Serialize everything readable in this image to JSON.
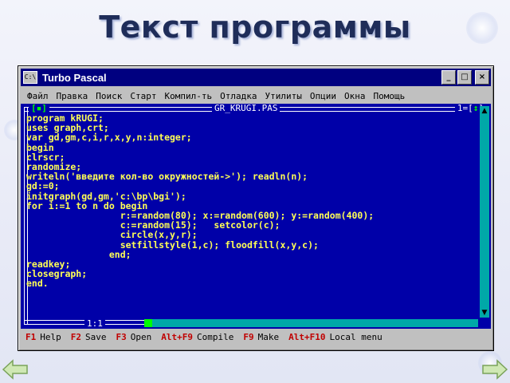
{
  "slide": {
    "title": "Текст программы"
  },
  "window": {
    "title": "Turbo Pascal",
    "icon_label": "C:\\",
    "buttons": {
      "minimize": "_",
      "maximize": "□",
      "close": "×"
    }
  },
  "menu": [
    "Файл",
    "Правка",
    "Поиск",
    "Старт",
    "Компил-ть",
    "Отладка",
    "Утилиты",
    "Опции",
    "Окна",
    "Помощь"
  ],
  "editor": {
    "filename": "GR_KRUGI.PAS",
    "window_number": "1",
    "top_left_marker": "[▪]",
    "resize_marker": "↕",
    "cursor_position": "1:1",
    "code": [
      "program kRUGI;",
      "uses graph,crt;",
      "var gd,gm,c,i,r,x,y,n:integer;",
      "begin",
      "clrscr;",
      "randomize;",
      "writeln('введите кол-во окружностей->'); readln(n);",
      "gd:=0;",
      "initgraph(gd,gm,'c:\\bp\\bgi');",
      "for i:=1 to n do begin",
      "                 r:=random(80); x:=random(600); y:=random(400);",
      "                 c:=random(15);   setcolor(c);",
      "                 circle(x,y,r);",
      "                 setfillstyle(1,c); floodfill(x,y,c);",
      "               end;",
      "readkey;",
      "closegraph;",
      "end."
    ]
  },
  "statusbar": [
    {
      "key": "F1",
      "label": "Help"
    },
    {
      "key": "F2",
      "label": "Save"
    },
    {
      "key": "F3",
      "label": "Open"
    },
    {
      "key": "Alt+F9",
      "label": "Compile"
    },
    {
      "key": "F9",
      "label": "Make"
    },
    {
      "key": "Alt+F10",
      "label": "Local menu"
    }
  ],
  "colors": {
    "editor_bg": "#0000a8",
    "code_text": "#ffff55",
    "title_bar": "#000080",
    "hotkey": "#c00000",
    "marker": "#00ff00"
  }
}
